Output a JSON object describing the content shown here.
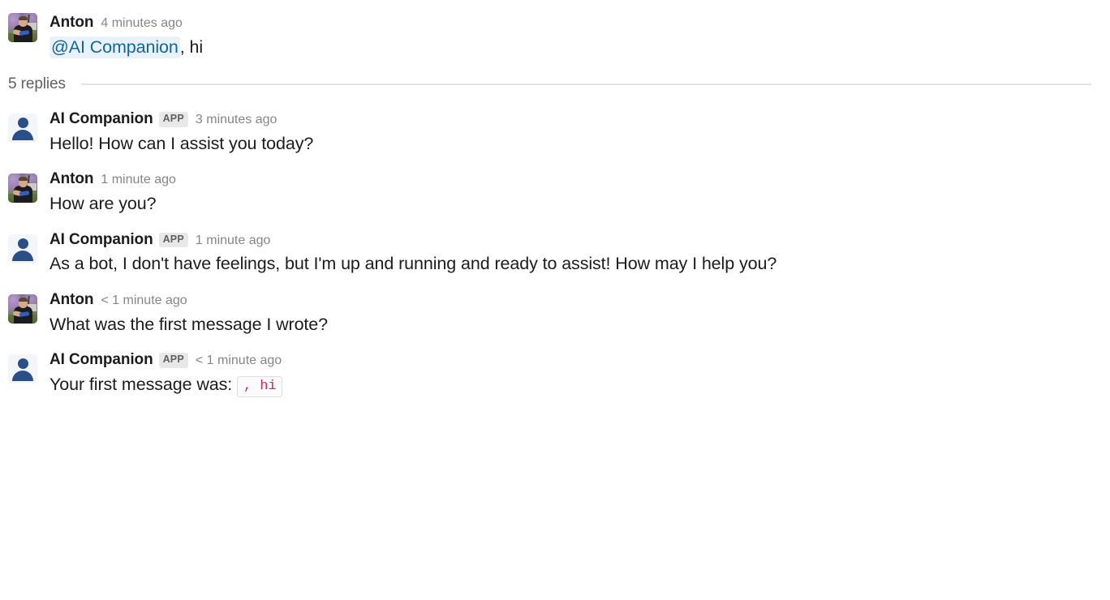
{
  "thread": {
    "root_message": {
      "author": "Anton",
      "avatar_type": "photo",
      "is_app": false,
      "timestamp": "4 minutes ago",
      "mention": "@AI Companion",
      "text_after_mention": ", hi"
    },
    "replies_divider": {
      "label": "5 replies"
    },
    "replies": [
      {
        "author": "AI Companion",
        "avatar_type": "default",
        "is_app": true,
        "app_badge": "APP",
        "timestamp": "3 minutes ago",
        "text": "Hello! How can I assist you today?"
      },
      {
        "author": "Anton",
        "avatar_type": "photo",
        "is_app": false,
        "app_badge": "",
        "timestamp": "1 minute ago",
        "text": "How are you?"
      },
      {
        "author": "AI Companion",
        "avatar_type": "default",
        "is_app": true,
        "app_badge": "APP",
        "timestamp": "1 minute ago",
        "text": "As a bot, I don't have feelings, but I'm up and running and ready to assist! How may I help you?"
      },
      {
        "author": "Anton",
        "avatar_type": "photo",
        "is_app": false,
        "app_badge": "",
        "timestamp": "< 1 minute ago",
        "text": "What was the first message I wrote?"
      },
      {
        "author": "AI Companion",
        "avatar_type": "default",
        "is_app": true,
        "app_badge": "APP",
        "timestamp": "< 1 minute ago",
        "text_before_code": "Your first message was:",
        "code": ", hi"
      }
    ]
  },
  "colors": {
    "text": "#1d1c1d",
    "muted": "#868686",
    "mention_text": "#1264a3",
    "mention_background": "#e8f2fc",
    "code_text": "#e01e5a",
    "app_badge_background": "#e8e8e8",
    "avatar_silhouette": "#2a4f86",
    "divider": "#e3e3e3",
    "page_background": "#ffffff"
  }
}
